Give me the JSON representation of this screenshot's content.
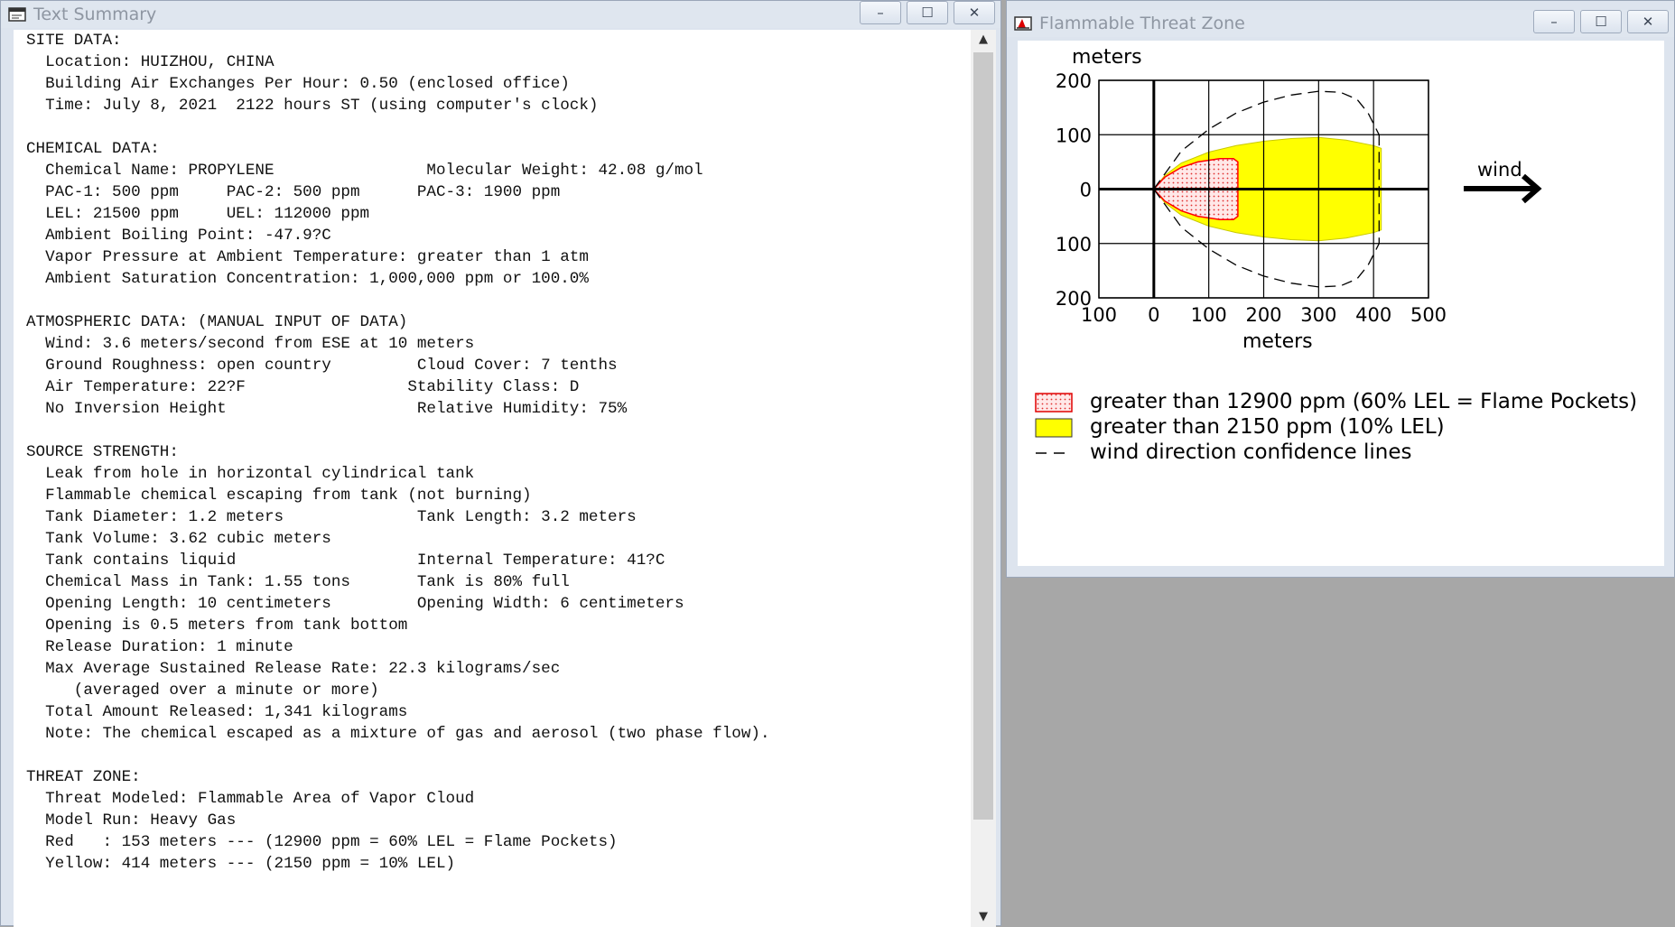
{
  "text_window": {
    "title": "Text Summary",
    "icon": "text-doc-icon",
    "controls": {
      "minimize": "–",
      "maximize": "☐",
      "close": "✕"
    },
    "site_data": {
      "heading": "SITE DATA:",
      "location": "  Location: HUIZHOU, CHINA",
      "air_exchanges": "  Building Air Exchanges Per Hour: 0.50 (enclosed office)",
      "time": "  Time: July 8, 2021  2122 hours ST (using computer's clock)"
    },
    "chemical_data": {
      "heading": "CHEMICAL DATA:",
      "name_weight": "  Chemical Name: PROPYLENE                Molecular Weight: 42.08 g/mol",
      "pac": "  PAC-1: 500 ppm     PAC-2: 500 ppm      PAC-3: 1900 ppm",
      "lel_uel": "  LEL: 21500 ppm     UEL: 112000 ppm",
      "boiling_point": "  Ambient Boiling Point: -47.9?C",
      "vapor_pressure": "  Vapor Pressure at Ambient Temperature: greater than 1 atm",
      "saturation": "  Ambient Saturation Concentration: 1,000,000 ppm or 100.0%"
    },
    "atmospheric_data": {
      "heading": "ATMOSPHERIC DATA: (MANUAL INPUT OF DATA)",
      "wind": "  Wind: 3.6 meters/second from ESE at 10 meters",
      "roughness_cloud": "  Ground Roughness: open country         Cloud Cover: 7 tenths",
      "temp_stability": "  Air Temperature: 22?F                 Stability Class: D",
      "inversion_humidity": "  No Inversion Height                    Relative Humidity: 75%"
    },
    "source_strength": {
      "heading": "SOURCE STRENGTH:",
      "leak": "  Leak from hole in horizontal cylindrical tank",
      "escaping": "  Flammable chemical escaping from tank (not burning)",
      "diameter_length": "  Tank Diameter: 1.2 meters              Tank Length: 3.2 meters",
      "volume": "  Tank Volume: 3.62 cubic meters",
      "liquid_temp": "  Tank contains liquid                   Internal Temperature: 41?C",
      "mass_full": "  Chemical Mass in Tank: 1.55 tons       Tank is 80% full",
      "opening_dims": "  Opening Length: 10 centimeters         Opening Width: 6 centimeters",
      "opening_position": "  Opening is 0.5 meters from tank bottom",
      "duration": "  Release Duration: 1 minute",
      "max_rate": "  Max Average Sustained Release Rate: 22.3 kilograms/sec",
      "averaged": "     (averaged over a minute or more)",
      "total": "  Total Amount Released: 1,341 kilograms",
      "note": "  Note: The chemical escaped as a mixture of gas and aerosol (two phase flow)."
    },
    "threat_zone": {
      "heading": "THREAT ZONE:",
      "modeled": "  Threat Modeled: Flammable Area of Vapor Cloud",
      "model_run": "  Model Run: Heavy Gas",
      "red": "  Red   : 153 meters --- (12900 ppm = 60% LEL = Flame Pockets)",
      "yellow": "  Yellow: 414 meters --- (2150 ppm = 10% LEL)"
    }
  },
  "threat_window": {
    "title": "Flammable Threat Zone",
    "icon": "threat-zone-icon",
    "controls": {
      "minimize": "–",
      "maximize": "☐",
      "close": "✕"
    },
    "wind_label": "wind",
    "legend": {
      "red": "greater than 12900 ppm (60% LEL = Flame Pockets)",
      "yellow": "greater than 2150 ppm (10% LEL)",
      "dashed": "wind direction confidence lines"
    },
    "colors": {
      "red_zone": "#ff0000",
      "yellow_zone": "#ffff00",
      "grid": "#000000"
    }
  },
  "chart_data": {
    "type": "area",
    "xlabel": "meters",
    "ylabel": "meters",
    "xlim": [
      -100,
      500
    ],
    "ylim": [
      -200,
      200
    ],
    "x_ticks": [
      -100,
      0,
      100,
      200,
      300,
      400,
      500
    ],
    "x_tick_labels": [
      "100",
      "0",
      "100",
      "200",
      "300",
      "400",
      "500"
    ],
    "y_ticks": [
      200,
      100,
      0,
      -100,
      -200
    ],
    "y_tick_labels": [
      "200",
      "100",
      "0",
      "100",
      "200"
    ],
    "grid": true,
    "series": [
      {
        "name": "greater than 2150 ppm (10% LEL)",
        "color": "#ffff00",
        "points": [
          [
            0,
            0
          ],
          [
            20,
            25
          ],
          [
            50,
            48
          ],
          [
            100,
            68
          ],
          [
            150,
            80
          ],
          [
            200,
            88
          ],
          [
            250,
            93
          ],
          [
            300,
            95
          ],
          [
            350,
            90
          ],
          [
            400,
            80
          ],
          [
            414,
            75
          ],
          [
            414,
            -75
          ],
          [
            400,
            -80
          ],
          [
            350,
            -90
          ],
          [
            300,
            -95
          ],
          [
            250,
            -93
          ],
          [
            200,
            -88
          ],
          [
            150,
            -80
          ],
          [
            100,
            -68
          ],
          [
            50,
            -48
          ],
          [
            20,
            -25
          ],
          [
            0,
            0
          ]
        ]
      },
      {
        "name": "greater than 12900 ppm (60% LEL = Flame Pockets)",
        "color": "#ff0000",
        "points": [
          [
            0,
            0
          ],
          [
            20,
            22
          ],
          [
            50,
            40
          ],
          [
            80,
            50
          ],
          [
            120,
            56
          ],
          [
            145,
            56
          ],
          [
            153,
            50
          ],
          [
            153,
            -50
          ],
          [
            145,
            -56
          ],
          [
            120,
            -56
          ],
          [
            80,
            -50
          ],
          [
            50,
            -40
          ],
          [
            20,
            -22
          ],
          [
            0,
            0
          ]
        ]
      },
      {
        "name": "wind direction confidence lines",
        "color": "#000000",
        "points": [
          [
            0,
            0
          ],
          [
            50,
            70
          ],
          [
            100,
            110
          ],
          [
            150,
            140
          ],
          [
            200,
            160
          ],
          [
            250,
            173
          ],
          [
            300,
            180
          ],
          [
            340,
            178
          ],
          [
            370,
            165
          ],
          [
            390,
            140
          ],
          [
            410,
            100
          ]
        ]
      },
      {
        "name": "wind direction confidence lines",
        "color": "#000000",
        "points": [
          [
            0,
            0
          ],
          [
            50,
            -70
          ],
          [
            100,
            -110
          ],
          [
            150,
            -140
          ],
          [
            200,
            -160
          ],
          [
            250,
            -173
          ],
          [
            300,
            -180
          ],
          [
            340,
            -178
          ],
          [
            370,
            -165
          ],
          [
            390,
            -140
          ],
          [
            410,
            -100
          ]
        ]
      },
      {
        "name": "wind direction confidence lines",
        "color": "#000000",
        "points": [
          [
            410,
            100
          ],
          [
            410,
            -100
          ]
        ]
      }
    ]
  }
}
